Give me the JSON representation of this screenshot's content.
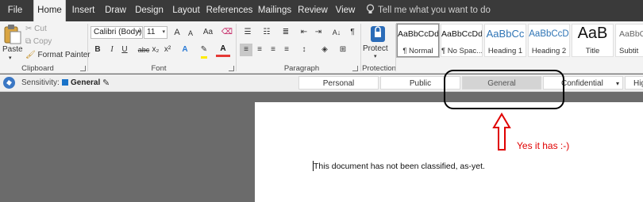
{
  "tabs": [
    "File",
    "Home",
    "Insert",
    "Draw",
    "Design",
    "Layout",
    "References",
    "Mailings",
    "Review",
    "View"
  ],
  "active_tab": "Home",
  "tell_me_placeholder": "Tell me what you want to do",
  "clipboard": {
    "paste": "Paste",
    "cut": "Cut",
    "copy": "Copy",
    "format_painter": "Format Painter",
    "label": "Clipboard"
  },
  "font": {
    "name": "Calibri (Body)",
    "size": "11",
    "grow": "A",
    "shrink": "A",
    "case": "Aa",
    "bold": "B",
    "italic": "I",
    "underline": "U",
    "strike": "abc",
    "sub": "x₂",
    "sup": "x²",
    "text_effects": "A",
    "font_color": "A",
    "label": "Font"
  },
  "paragraph": {
    "sort": "A↓",
    "marks": "¶",
    "label": "Paragraph"
  },
  "protection": {
    "protect": "Protect",
    "label": "Protection"
  },
  "styles": [
    {
      "preview": "AaBbCcDd",
      "name": "¶ Normal"
    },
    {
      "preview": "AaBbCcDd",
      "name": "¶ No Spac..."
    },
    {
      "preview": "AaBbCc",
      "name": "Heading 1"
    },
    {
      "preview": "AaBbCcD",
      "name": "Heading 2"
    },
    {
      "preview": "AaB",
      "name": "Title"
    },
    {
      "preview": "AaBbC",
      "name": "Subtit"
    }
  ],
  "sensitivity": {
    "label": "Sensitivity:",
    "current": "General",
    "levels": [
      "Personal",
      "Public",
      "General",
      "Confidential",
      "Hig"
    ],
    "selected": "General"
  },
  "document": {
    "text": "This document has not been classified, as-yet."
  },
  "annotation": {
    "text": "Yes it has :-)"
  },
  "colors": {
    "accent": "#2b579a",
    "annotation": "#e00000",
    "sensitivity_swatch": "#1a73c9"
  }
}
